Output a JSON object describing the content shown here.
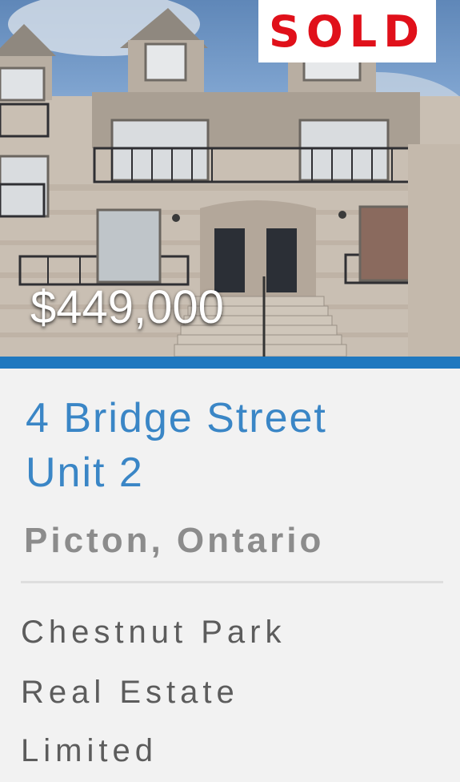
{
  "listing": {
    "status_badge": "SOLD",
    "price": "$449,000",
    "address_line1": "4 Bridge Street",
    "address_line2": "Unit 2",
    "city": "Picton, Ontario",
    "brokerage_line1": "Chestnut Park",
    "brokerage_line2": "Real Estate",
    "brokerage_line3": "Limited"
  },
  "colors": {
    "accent_blue": "#1f78bf",
    "address_blue": "#3a86c6",
    "sold_red": "#e0101a"
  }
}
